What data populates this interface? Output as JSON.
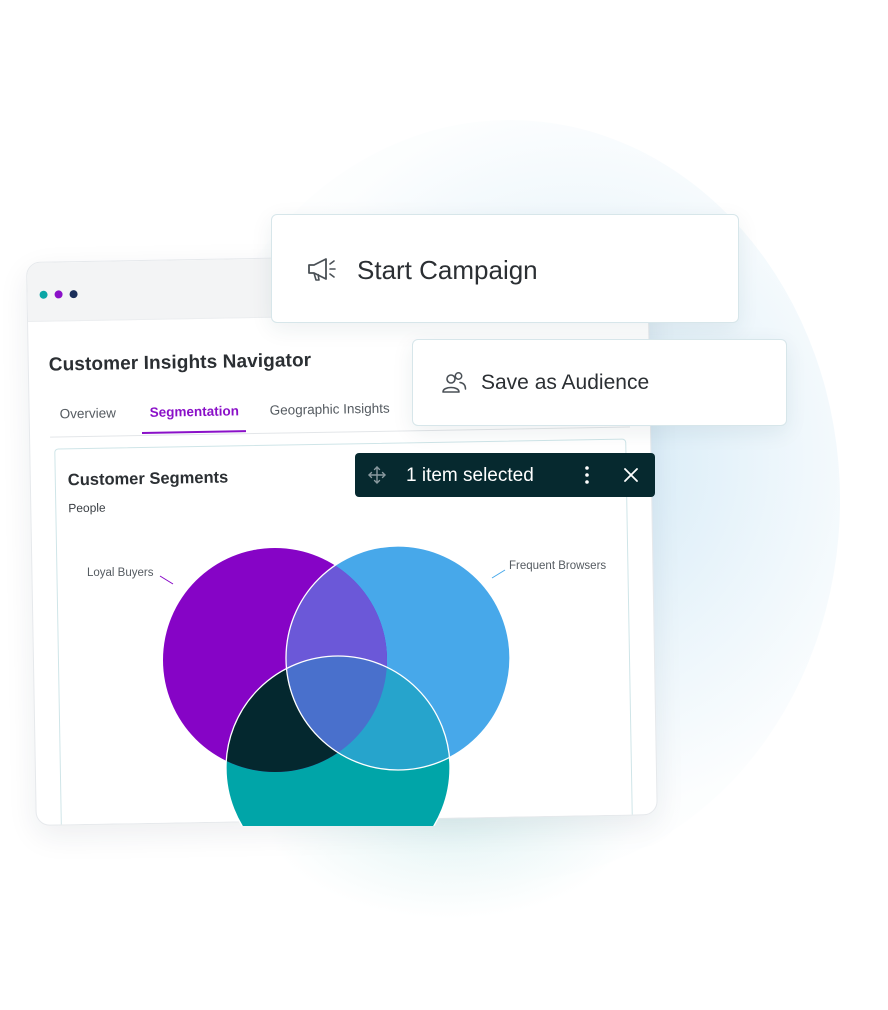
{
  "window": {
    "title": "Customer Insights Navigator",
    "tabs": [
      {
        "label": "Overview",
        "active": false
      },
      {
        "label": "Segmentation",
        "active": true
      },
      {
        "label": "Geographic Insights",
        "active": false
      }
    ]
  },
  "card": {
    "title": "Customer Segments",
    "subtitle": "People"
  },
  "venn": {
    "labels": {
      "loyal_buyers": "Loyal Buyers",
      "frequent_browsers": "Frequent Browsers"
    },
    "colors": {
      "loyal_buyers": "#8604c6",
      "frequent_browsers": "#47a8ea",
      "third_segment": "#00a5a8",
      "overlap_lb_fb": "#6b58d8",
      "overlap_lb_third": "#04282f",
      "overlap_fb_third": "#26a4cc",
      "overlap_all": "#4970cc"
    }
  },
  "actions": {
    "start_campaign": {
      "label": "Start Campaign",
      "icon": "megaphone-icon"
    },
    "save_audience": {
      "label": "Save as Audience",
      "icon": "people-icon"
    }
  },
  "selection": {
    "text": "1 item selected",
    "icons": [
      "move-icon",
      "more-vertical-icon",
      "close-icon"
    ]
  },
  "accent": "#8a10c8"
}
